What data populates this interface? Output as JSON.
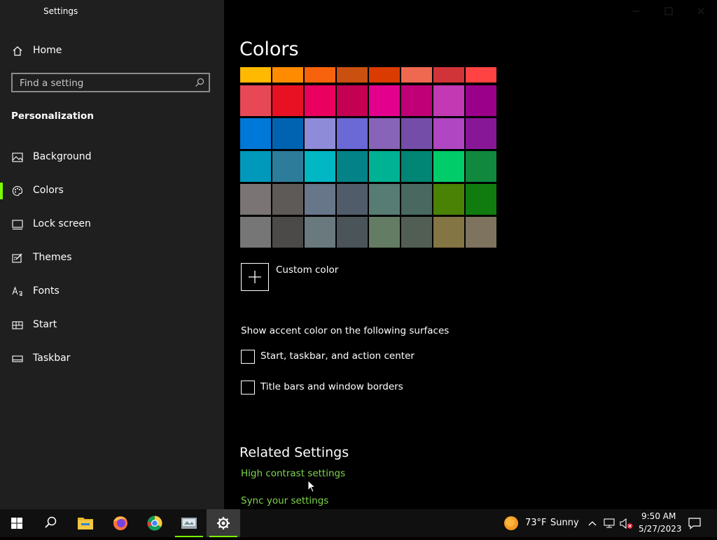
{
  "window": {
    "title": "Settings"
  },
  "sidebar": {
    "home_label": "Home",
    "search_placeholder": "Find a setting",
    "section": "Personalization",
    "items": [
      {
        "label": "Background",
        "icon": "picture-icon",
        "selected": false
      },
      {
        "label": "Colors",
        "icon": "palette-icon",
        "selected": true
      },
      {
        "label": "Lock screen",
        "icon": "lock-screen-icon",
        "selected": false
      },
      {
        "label": "Themes",
        "icon": "themes-icon",
        "selected": false
      },
      {
        "label": "Fonts",
        "icon": "fonts-icon",
        "selected": false
      },
      {
        "label": "Start",
        "icon": "start-icon",
        "selected": false
      },
      {
        "label": "Taskbar",
        "icon": "taskbar-icon",
        "selected": false
      }
    ]
  },
  "main": {
    "title": "Colors",
    "swatch_rows": [
      [
        "#FFB900",
        "#FF8C00",
        "#F7630C",
        "#CA5010",
        "#DA3B01",
        "#EF6950",
        "#D13438",
        "#FF4343"
      ],
      [
        "#E74856",
        "#E81123",
        "#EA005E",
        "#C30052",
        "#E3008C",
        "#BF0077",
        "#C239B3",
        "#9A0089"
      ],
      [
        "#0078D7",
        "#0063B1",
        "#8E8CD8",
        "#6B69D6",
        "#8764B8",
        "#744DA9",
        "#B146C2",
        "#881798"
      ],
      [
        "#0099BC",
        "#2D7D9A",
        "#00B7C3",
        "#038387",
        "#00B294",
        "#018574",
        "#00CC6A",
        "#10893E"
      ],
      [
        "#7A7574",
        "#5D5A58",
        "#68768A",
        "#515C6B",
        "#567C73",
        "#486860",
        "#498205",
        "#107C10"
      ],
      [
        "#767676",
        "#4C4A48",
        "#69797E",
        "#4A5459",
        "#647C64",
        "#525E54",
        "#847545",
        "#7E735F"
      ]
    ],
    "custom_color_label": "Custom color",
    "surfaces_heading": "Show accent color on the following surfaces",
    "checkboxes": [
      {
        "label": "Start, taskbar, and action center",
        "checked": false
      },
      {
        "label": "Title bars and window borders",
        "checked": false
      }
    ],
    "related_heading": "Related Settings",
    "links": [
      "High contrast settings",
      "Sync your settings"
    ]
  },
  "taskbar": {
    "apps": [
      "start-icon",
      "search-icon",
      "file-explorer-icon",
      "firefox-icon",
      "chrome-icon",
      "app-icon",
      "settings-icon"
    ],
    "weather": {
      "temp": "73°F",
      "condition": "Sunny"
    },
    "clock": {
      "time": "9:50 AM",
      "date": "5/27/2023"
    }
  },
  "colors": {
    "accent": "#7CFC00",
    "link": "#7FD74D",
    "sidebar_bg": "#1F1F1F"
  }
}
